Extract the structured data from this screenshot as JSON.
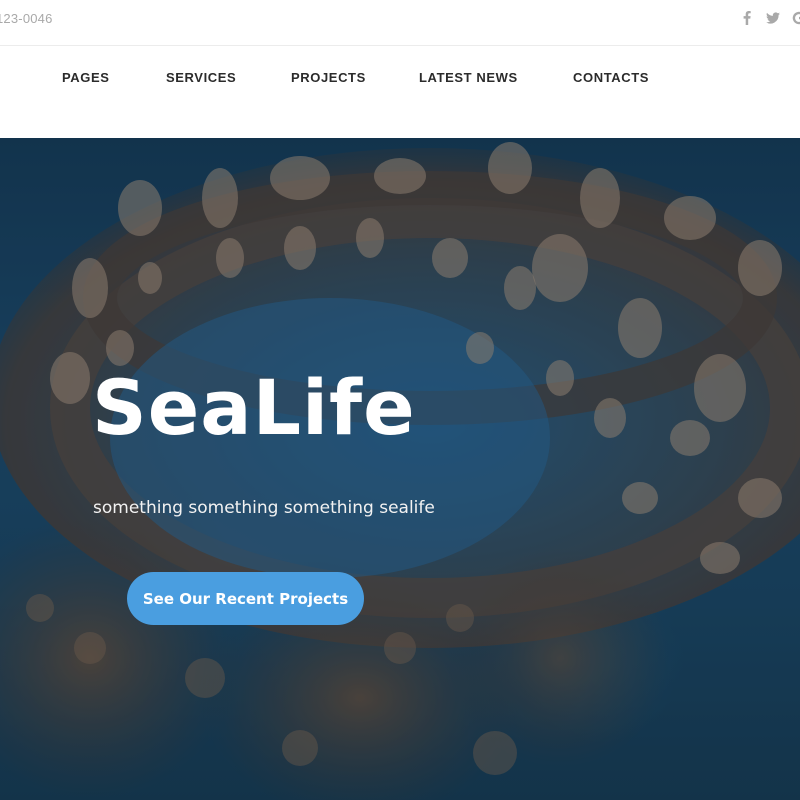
{
  "topbar": {
    "phone": "123-0046",
    "social": [
      {
        "icon": "facebook-icon"
      },
      {
        "icon": "twitter-icon"
      },
      {
        "icon": "google-icon"
      }
    ]
  },
  "nav": {
    "items": [
      {
        "label": "PAGES"
      },
      {
        "label": "SERVICES"
      },
      {
        "label": "PROJECTS"
      },
      {
        "label": "LATEST NEWS"
      },
      {
        "label": "CONTACTS"
      }
    ]
  },
  "hero": {
    "title": "SeaLife",
    "subtitle": "something something something sealife",
    "cta_label": "See Our Recent Projects"
  },
  "colors": {
    "accent": "#4a9ee0",
    "hero_bg": "#1c4a6d",
    "nav_text": "#2b2b2b",
    "muted_text": "#a9a9a9"
  }
}
